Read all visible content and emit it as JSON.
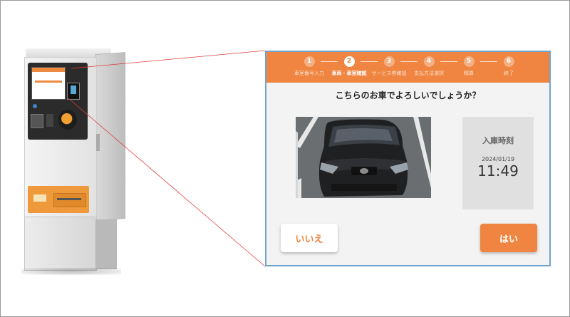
{
  "colors": {
    "accent": "#ef8540",
    "screen_border": "#6ea3cf",
    "zoom_line": "#e23b3b"
  },
  "steps": [
    {
      "num": "1",
      "label": "車室番号入力",
      "active": false
    },
    {
      "num": "2",
      "label": "車両・車室確認",
      "active": true
    },
    {
      "num": "3",
      "label": "サービス券確認",
      "active": false
    },
    {
      "num": "4",
      "label": "支払方法選択",
      "active": false
    },
    {
      "num": "5",
      "label": "精算",
      "active": false
    },
    {
      "num": "6",
      "label": "終了",
      "active": false
    }
  ],
  "question": "こちらのお車でよろしいでしょうか？",
  "entry": {
    "label": "入庫時刻",
    "date": "2024/01/19",
    "time": "11:49"
  },
  "buttons": {
    "no": "いいえ",
    "yes": "はい"
  },
  "kiosk": {
    "image": "parking-payment-machine"
  }
}
